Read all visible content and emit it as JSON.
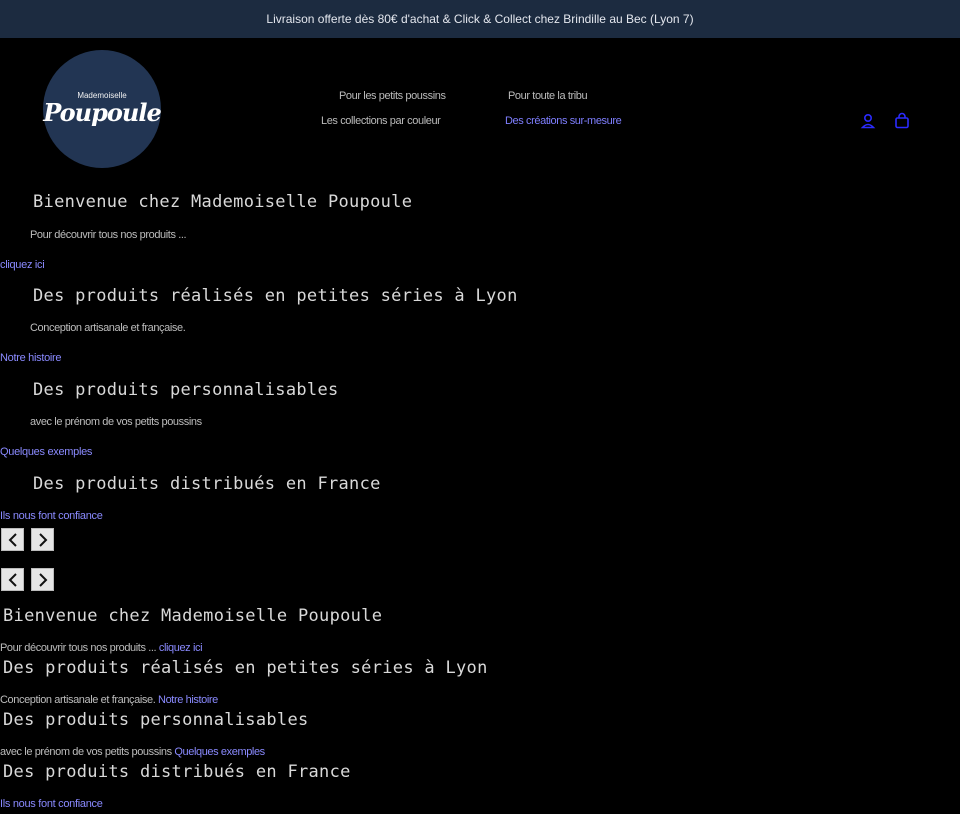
{
  "announcement": {
    "text": "Livraison offerte dès 80€ d'achat & Click & Collect chez Brindille au Bec (Lyon 7)"
  },
  "logo": {
    "line1": "Mademoiselle",
    "line2": "Poupoule"
  },
  "nav": {
    "items": [
      {
        "label": "Pour les petits poussins"
      },
      {
        "label": "Pour toute la tribu"
      },
      {
        "label": "Les collections par couleur"
      },
      {
        "label": "Des créations sur-mesure"
      }
    ]
  },
  "header_icons": {
    "account": "account-icon",
    "cart": "cart-icon"
  },
  "slideshow": {
    "slides": [
      {
        "title": "Bienvenue chez Mademoiselle Poupoule",
        "text": "Pour découvrir tous nos produits ...",
        "link": "cliquez ici"
      },
      {
        "title": "Des produits réalisés en petites séries à Lyon",
        "text": "Conception artisanale et française.",
        "link": "Notre histoire"
      },
      {
        "title": "Des produits personnalisables",
        "text": "avec le prénom de vos petits poussins",
        "link": "Quelques exemples"
      },
      {
        "title": "Des produits distribués en France",
        "text": "",
        "link": "Ils nous font confiance"
      }
    ],
    "prev_icon": "chevron-left-icon",
    "next_icon": "chevron-right-icon"
  },
  "colors": {
    "announcement_bg": "#1c2b40",
    "logo_bg": "#223553",
    "link": "#8a8aff",
    "page_bg": "#000000"
  }
}
